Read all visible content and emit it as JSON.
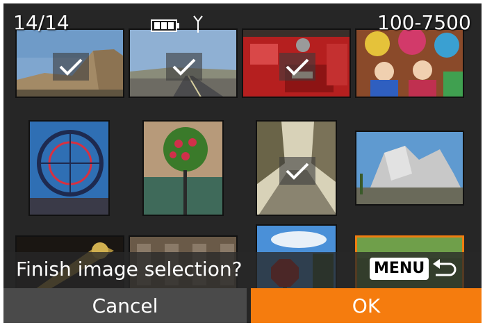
{
  "status": {
    "counter": "14/14",
    "folder_file": "100-7500",
    "battery_icon": "battery-icon",
    "antenna_icon": "antenna-icon"
  },
  "thumbnails": [
    {
      "desc": "rocky landscape",
      "selected": true
    },
    {
      "desc": "desert road",
      "selected": true
    },
    {
      "desc": "red fire truck",
      "selected": true
    },
    {
      "desc": "colorful puppets",
      "selected": false
    },
    {
      "desc": "ferris wheel",
      "selected": false
    },
    {
      "desc": "hanging flower basket",
      "selected": false
    },
    {
      "desc": "city street",
      "selected": true
    },
    {
      "desc": "modern building",
      "selected": false
    },
    {
      "desc": "musical instrument",
      "selected": false
    },
    {
      "desc": "building facade",
      "selected": false
    },
    {
      "desc": "stop sign and sky",
      "selected": false
    },
    {
      "desc": "green grass",
      "selected": false
    }
  ],
  "prompt": {
    "text": "Finish image selection?",
    "menu_label": "MENU"
  },
  "buttons": {
    "cancel": "Cancel",
    "ok": "OK"
  },
  "colors": {
    "background": "#262626",
    "ok_orange": "#F57C0E",
    "cancel_gray": "#4A4A4A",
    "highlight_orange": "#F07D10"
  }
}
